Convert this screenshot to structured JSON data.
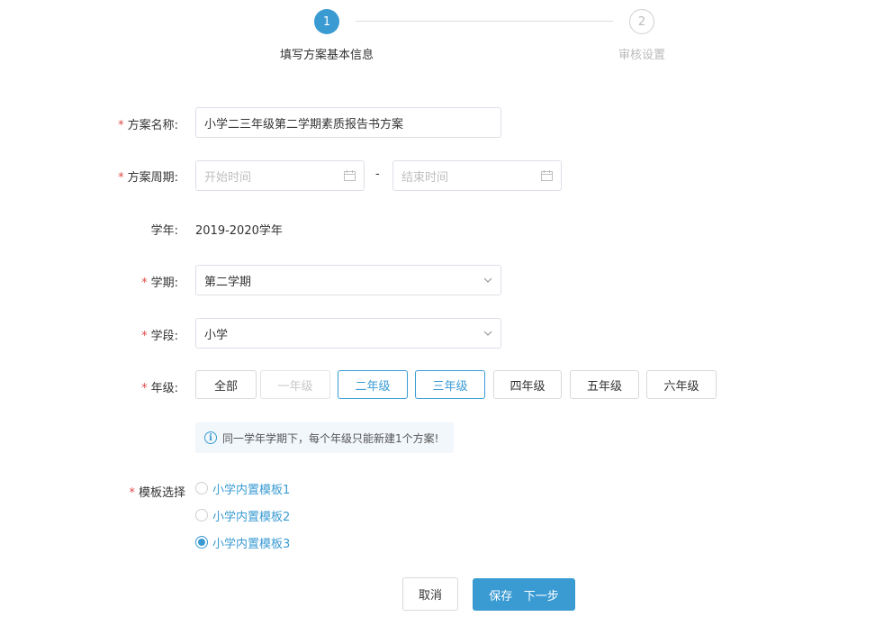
{
  "steps": [
    {
      "number": "1",
      "title": "填写方案基本信息",
      "state": "active"
    },
    {
      "number": "2",
      "title": "审核设置",
      "state": "inactive"
    }
  ],
  "form": {
    "required_mark": "*",
    "plan_name": {
      "label": "方案名称:",
      "value": "小学二三年级第二学期素质报告书方案"
    },
    "period": {
      "label": "方案周期:",
      "start_placeholder": "开始时间",
      "separator": "-",
      "end_placeholder": "结束时间"
    },
    "school_year": {
      "label": "学年:",
      "value": "2019-2020学年"
    },
    "semester": {
      "label": "学期:",
      "value": "第二学期"
    },
    "stage": {
      "label": "学段:",
      "value": "小学"
    },
    "grade": {
      "label": "年级:",
      "options": [
        {
          "label": "全部",
          "state": "normal"
        },
        {
          "label": "一年级",
          "state": "disabled"
        },
        {
          "label": "二年级",
          "state": "selected"
        },
        {
          "label": "三年级",
          "state": "selected"
        },
        {
          "label": "四年级",
          "state": "normal"
        },
        {
          "label": "五年级",
          "state": "normal"
        },
        {
          "label": "六年级",
          "state": "normal"
        }
      ]
    },
    "notice": {
      "icon": "info-icon",
      "text": "同一学年学期下，每个年级只能新建1个方案!"
    },
    "template": {
      "label": "模板选择",
      "options": [
        {
          "label": "小学内置模板1",
          "checked": false
        },
        {
          "label": "小学内置模板2",
          "checked": false
        },
        {
          "label": "小学内置模板3",
          "checked": true
        }
      ]
    }
  },
  "actions": {
    "cancel_label": "取消",
    "primary_label": "保存   下一步"
  },
  "colors": {
    "accent": "#3a9bd3",
    "required": "#e04b4b",
    "notice_bg": "#f2f7fc"
  }
}
